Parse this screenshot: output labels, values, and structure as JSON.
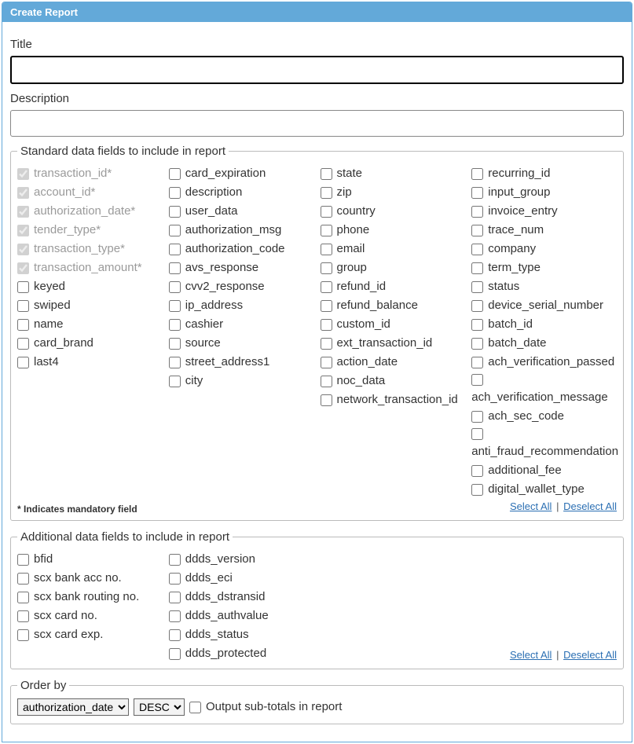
{
  "header": {
    "title": "Create Report"
  },
  "fields": {
    "title_label": "Title",
    "title_value": "",
    "description_label": "Description",
    "description_value": ""
  },
  "std": {
    "legend": "Standard data fields to include in report",
    "mandatory_note": "* Indicates mandatory field",
    "select_all": "Select All",
    "deselect_all": "Deselect All",
    "col1": [
      {
        "label": "transaction_id*",
        "checked": true,
        "disabled": true
      },
      {
        "label": "account_id*",
        "checked": true,
        "disabled": true
      },
      {
        "label": "authorization_date*",
        "checked": true,
        "disabled": true
      },
      {
        "label": "tender_type*",
        "checked": true,
        "disabled": true
      },
      {
        "label": "transaction_type*",
        "checked": true,
        "disabled": true
      },
      {
        "label": "transaction_amount*",
        "checked": true,
        "disabled": true
      },
      {
        "label": "keyed",
        "checked": false,
        "disabled": false
      },
      {
        "label": "swiped",
        "checked": false,
        "disabled": false
      },
      {
        "label": "name",
        "checked": false,
        "disabled": false
      },
      {
        "label": "card_brand",
        "checked": false,
        "disabled": false
      },
      {
        "label": "last4",
        "checked": false,
        "disabled": false
      }
    ],
    "col2": [
      {
        "label": "card_expiration",
        "checked": false,
        "disabled": false
      },
      {
        "label": "description",
        "checked": false,
        "disabled": false
      },
      {
        "label": "user_data",
        "checked": false,
        "disabled": false
      },
      {
        "label": "authorization_msg",
        "checked": false,
        "disabled": false
      },
      {
        "label": "authorization_code",
        "checked": false,
        "disabled": false
      },
      {
        "label": "avs_response",
        "checked": false,
        "disabled": false
      },
      {
        "label": "cvv2_response",
        "checked": false,
        "disabled": false
      },
      {
        "label": "ip_address",
        "checked": false,
        "disabled": false
      },
      {
        "label": "cashier",
        "checked": false,
        "disabled": false
      },
      {
        "label": "source",
        "checked": false,
        "disabled": false
      },
      {
        "label": "street_address1",
        "checked": false,
        "disabled": false
      },
      {
        "label": "city",
        "checked": false,
        "disabled": false
      }
    ],
    "col3": [
      {
        "label": "state",
        "checked": false,
        "disabled": false
      },
      {
        "label": "zip",
        "checked": false,
        "disabled": false
      },
      {
        "label": "country",
        "checked": false,
        "disabled": false
      },
      {
        "label": "phone",
        "checked": false,
        "disabled": false
      },
      {
        "label": "email",
        "checked": false,
        "disabled": false
      },
      {
        "label": "group",
        "checked": false,
        "disabled": false
      },
      {
        "label": "refund_id",
        "checked": false,
        "disabled": false
      },
      {
        "label": "refund_balance",
        "checked": false,
        "disabled": false
      },
      {
        "label": "custom_id",
        "checked": false,
        "disabled": false
      },
      {
        "label": "ext_transaction_id",
        "checked": false,
        "disabled": false
      },
      {
        "label": "action_date",
        "checked": false,
        "disabled": false
      },
      {
        "label": "noc_data",
        "checked": false,
        "disabled": false
      },
      {
        "label": "network_transaction_id",
        "checked": false,
        "disabled": false
      }
    ],
    "col4": [
      {
        "label": "recurring_id",
        "checked": false,
        "disabled": false
      },
      {
        "label": "input_group",
        "checked": false,
        "disabled": false
      },
      {
        "label": "invoice_entry",
        "checked": false,
        "disabled": false
      },
      {
        "label": "trace_num",
        "checked": false,
        "disabled": false
      },
      {
        "label": "company",
        "checked": false,
        "disabled": false
      },
      {
        "label": "term_type",
        "checked": false,
        "disabled": false
      },
      {
        "label": "status",
        "checked": false,
        "disabled": false
      },
      {
        "label": "device_serial_number",
        "checked": false,
        "disabled": false
      },
      {
        "label": "batch_id",
        "checked": false,
        "disabled": false
      },
      {
        "label": "batch_date",
        "checked": false,
        "disabled": false
      },
      {
        "label": "ach_verification_passed",
        "checked": false,
        "disabled": false
      },
      {
        "label": "ach_verification_message",
        "checked": false,
        "disabled": false
      },
      {
        "label": "ach_sec_code",
        "checked": false,
        "disabled": false
      },
      {
        "label": "anti_fraud_recommendation",
        "checked": false,
        "disabled": false
      },
      {
        "label": "additional_fee",
        "checked": false,
        "disabled": false
      },
      {
        "label": "digital_wallet_type",
        "checked": false,
        "disabled": false
      }
    ]
  },
  "addl": {
    "legend": "Additional data fields to include in report",
    "select_all": "Select All",
    "deselect_all": "Deselect All",
    "col1": [
      {
        "label": "bfid",
        "checked": false
      },
      {
        "label": "scx bank acc no.",
        "checked": false
      },
      {
        "label": "scx bank routing no.",
        "checked": false
      },
      {
        "label": "scx card no.",
        "checked": false
      },
      {
        "label": "scx card exp.",
        "checked": false
      }
    ],
    "col2": [
      {
        "label": "ddds_version",
        "checked": false
      },
      {
        "label": "ddds_eci",
        "checked": false
      },
      {
        "label": "ddds_dstransid",
        "checked": false
      },
      {
        "label": "ddds_authvalue",
        "checked": false
      },
      {
        "label": "ddds_status",
        "checked": false
      },
      {
        "label": "ddds_protected",
        "checked": false
      }
    ]
  },
  "order": {
    "legend": "Order by",
    "field_selected": "authorization_date",
    "dir_selected": "DESC",
    "subtotal_label": "Output sub-totals in report",
    "subtotal_checked": false
  }
}
